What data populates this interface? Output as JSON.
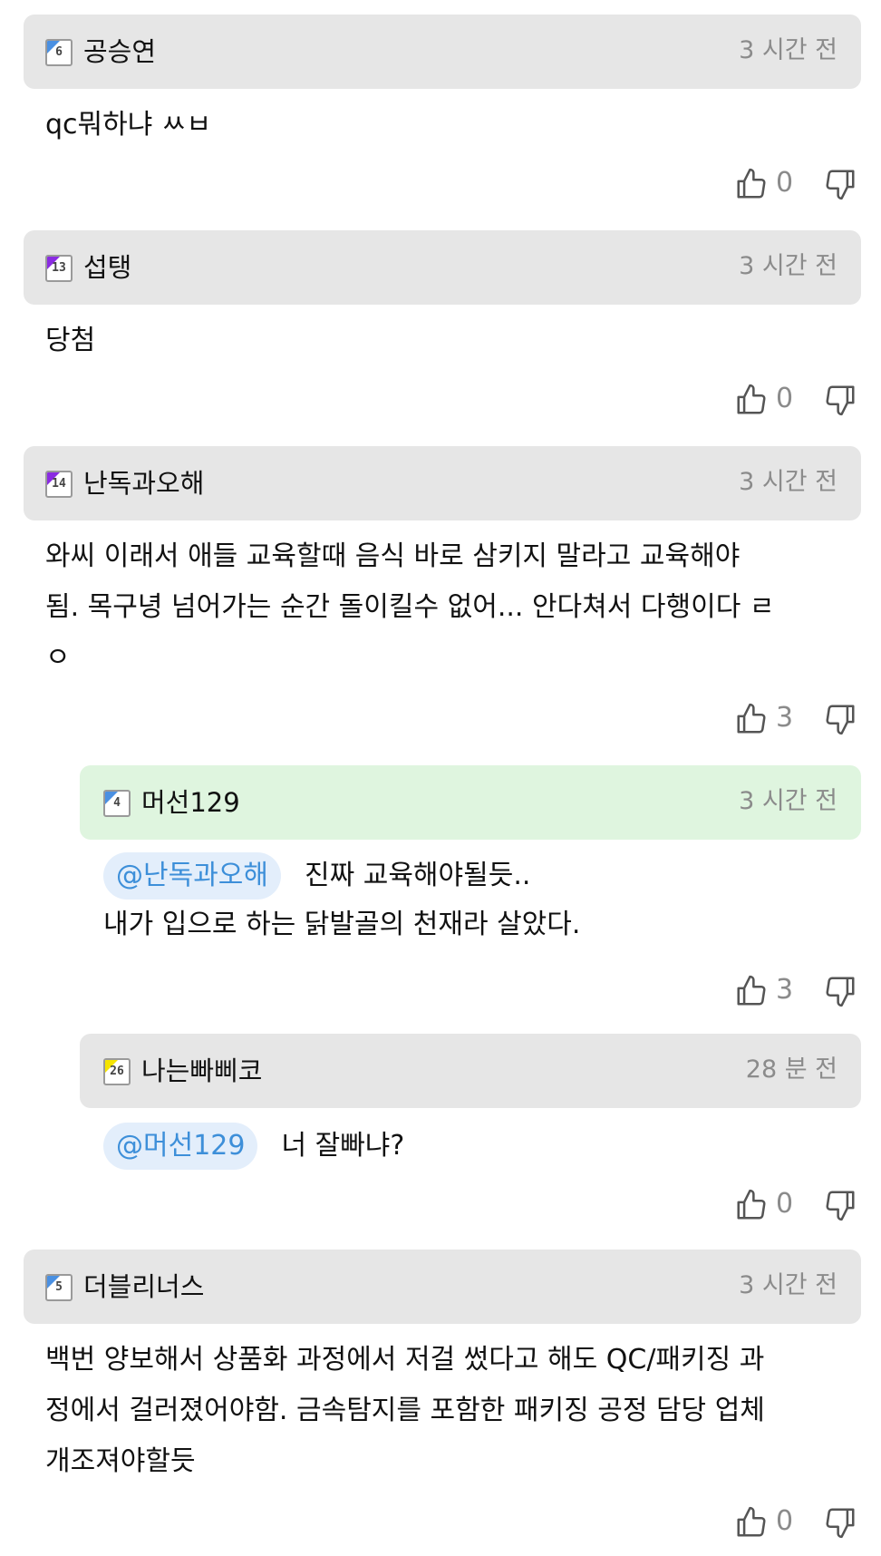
{
  "comments": [
    {
      "user": "공승연",
      "level": "6",
      "level_color": "#4a90e2",
      "time": "3 시간 전",
      "text": "qc뭐하냐 ㅆㅂ",
      "likes": "0"
    },
    {
      "user": "섭탱",
      "level": "13",
      "level_color": "#8a2be2",
      "time": "3 시간 전",
      "text": "당첨",
      "likes": "0"
    },
    {
      "user": "난독과오해",
      "level": "14",
      "level_color": "#8a2be2",
      "time": "3 시간 전",
      "text": "와씨 이래서 애들 교육할때 음식 바로 삼키지 말라고 교육해야\n됨. 목구녕 넘어가는 순간 돌이킬수 없어... 안다쳐서 다행이다 ㄹ\nㅇ",
      "likes": "3"
    },
    {
      "user": "머선129",
      "level": "4",
      "level_color": "#4a90e2",
      "time": "3 시간 전",
      "mention": "@난독과오해",
      "text_line1": "진짜 교육해야될듯..",
      "text_line2": "내가 입으로 하는 닭발골의 천재라 살았다.",
      "likes": "3"
    },
    {
      "user": "나는빠삐코",
      "level": "26",
      "level_color": "#f5e400",
      "time": "28 분 전",
      "mention": "@머선129",
      "text_line1": "너 잘빠냐?",
      "likes": "0"
    },
    {
      "user": "더블리너스",
      "level": "5",
      "level_color": "#4a90e2",
      "time": "3 시간 전",
      "text": "백번 양보해서 상품화 과정에서 저걸 썼다고 해도 QC/패키징 과\n정에서 걸러졌어야함. 금속탐지를 포함한 패키징 공정 담당 업체\n개조져야할듯",
      "likes": "0"
    }
  ],
  "icons": {
    "like": "thumbs-up-icon",
    "dislike": "thumbs-down-icon"
  },
  "colors": {
    "header_bg": "#e6e6e6",
    "reply_highlight_bg": "#dff5df",
    "mention_text": "#3d8fd9",
    "mention_bg": "#e3eefb"
  }
}
